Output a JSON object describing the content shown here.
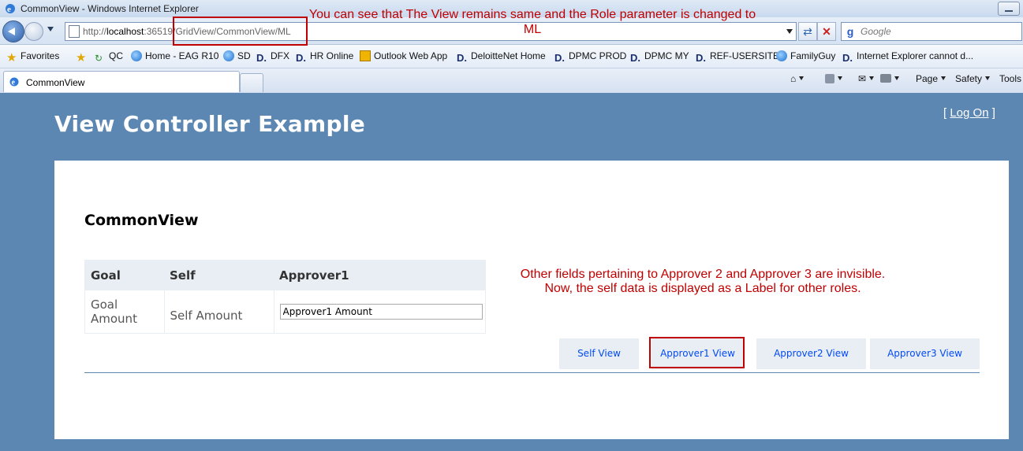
{
  "window": {
    "title": "CommonView - Windows Internet Explorer"
  },
  "address_bar": {
    "url_prefix": "http://",
    "url_host": "localhost",
    "url_rest": ":36519/GridView/CommonView/ML"
  },
  "search": {
    "placeholder": "Google"
  },
  "favorites_bar": {
    "favorites_label": "Favorites",
    "items": [
      "QC",
      "Home - EAG R10",
      "SD",
      "DFX",
      "HR Online",
      "Outlook Web App",
      "DeloitteNet Home",
      "DPMC PROD",
      "DPMC MY",
      "REF-USERSITE",
      "FamilyGuy",
      "Internet Explorer cannot d..."
    ]
  },
  "tab": {
    "label": "CommonView"
  },
  "command_bar": {
    "page": "Page",
    "safety": "Safety",
    "tools": "Tools"
  },
  "site": {
    "title": "View Controller Example",
    "logon_open": "[",
    "logon_link": "Log On",
    "logon_close": "]"
  },
  "main": {
    "view_title": "CommonView",
    "grid": {
      "headers": [
        "Goal",
        "Self",
        "Approver1"
      ],
      "row": {
        "goal": "Goal Amount",
        "self": "Self Amount",
        "approver1_value": "Approver1 Amount"
      }
    },
    "buttons": [
      "Self View",
      "Approver1 View",
      "Approver2 View",
      "Approver3 View"
    ]
  },
  "annotations": {
    "top_note_line1": "You can see that The View remains same and the Role parameter is changed to",
    "top_note_line2": "ML",
    "side_note_line1": "Other fields pertaining to Approver 2 and Approver 3 are invisible.",
    "side_note_line2": "Now, the self data is displayed as a Label for other roles."
  },
  "colors": {
    "page_bg": "#5c87b2",
    "annotation": "#c00000",
    "link_blue": "#034af3"
  }
}
